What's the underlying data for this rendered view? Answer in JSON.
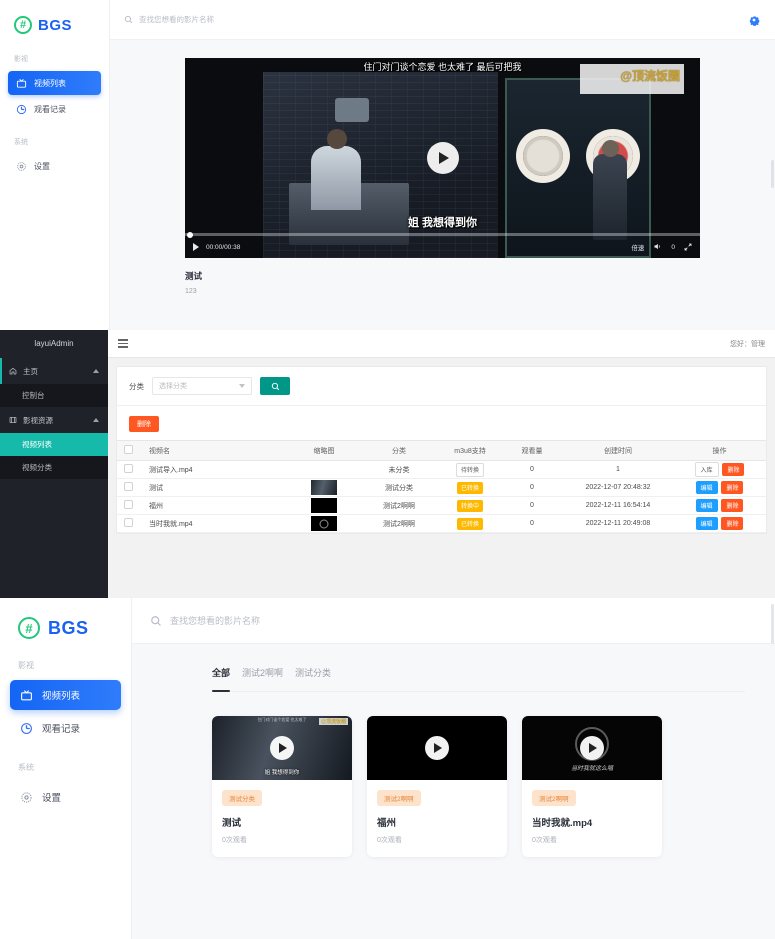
{
  "brand": {
    "name": "BGS",
    "mark": "#"
  },
  "colors": {
    "accent_blue": "#1565f5",
    "brand_green": "#21c978",
    "admin_teal": "#16baaa",
    "danger": "#ff5722",
    "warn": "#ffb800",
    "info": "#1e9fff"
  },
  "panel1": {
    "search": {
      "placeholder": "查找您想看的影片名称",
      "value": "",
      "icon": "search-icon"
    },
    "settings_icon": "gear-icon",
    "sidebar": {
      "groups": [
        {
          "label": "影视",
          "items": [
            {
              "label": "视频列表",
              "icon": "tv-icon",
              "active": true
            },
            {
              "label": "观看记录",
              "icon": "history-icon",
              "active": false
            }
          ]
        },
        {
          "label": "系统",
          "items": [
            {
              "label": "设置",
              "icon": "gear-icon",
              "active": false
            }
          ]
        }
      ]
    },
    "player": {
      "subtitle_top": "住门对门谈个恋爱 也太难了 最后可把我",
      "watermark": "@顶流饭圈",
      "subtitle_bottom": "姐 我想得到你",
      "time": "00:00/00:38",
      "speed_label": "倍速",
      "volume": "0",
      "play_icon": "play-icon",
      "fullscreen_icon": "fullscreen-icon",
      "volume_icon": "volume-icon"
    },
    "video": {
      "title": "测试",
      "description": "123"
    }
  },
  "panel2": {
    "brand": "layuiAdmin",
    "user_greeting": "您好：管理",
    "menu_icon": "hamburger-icon",
    "nav": [
      {
        "label": "主页",
        "icon": "home-icon",
        "expanded": true
      },
      {
        "label": "控制台",
        "sub": true,
        "active": false
      },
      {
        "label": "影视资源",
        "icon": "film-icon",
        "expanded": true
      },
      {
        "label": "视频列表",
        "sub": true,
        "active": true
      },
      {
        "label": "视频分类",
        "sub": true,
        "active": false
      }
    ],
    "filter": {
      "label": "分类",
      "select_placeholder": "选择分类",
      "search_icon": "search-icon"
    },
    "delete_button": "删除",
    "table": {
      "columns": [
        "",
        "视频名",
        "缩略图",
        "分类",
        "m3u8支持",
        "观看量",
        "创建时间",
        "操作"
      ],
      "rows": [
        {
          "name": "测试导入.mp4",
          "thumb": "none",
          "category": "未分类",
          "m3u8": "待转换",
          "m3u8_style": "wait",
          "views": "0",
          "created": "1",
          "actions": [
            "入库",
            "删除"
          ],
          "action_styles": [
            "ghost",
            "del"
          ]
        },
        {
          "name": "测试",
          "thumb": "img1",
          "category": "测试分类",
          "m3u8": "已转换",
          "m3u8_style": "warm",
          "views": "0",
          "created": "2022-12-07 20:48:32",
          "actions": [
            "编辑",
            "删除"
          ],
          "action_styles": [
            "edit",
            "del"
          ]
        },
        {
          "name": "福州",
          "thumb": "img2",
          "category": "测试2啊啊",
          "m3u8": "转换中",
          "m3u8_style": "warm",
          "views": "0",
          "created": "2022-12-11 16:54:14",
          "actions": [
            "编辑",
            "删除"
          ],
          "action_styles": [
            "edit",
            "del"
          ]
        },
        {
          "name": "当时我就.mp4",
          "thumb": "img3",
          "category": "测试2啊啊",
          "m3u8": "已转换",
          "m3u8_style": "warm",
          "views": "0",
          "created": "2022-12-11 20:49:08",
          "actions": [
            "编辑",
            "删除"
          ],
          "action_styles": [
            "edit",
            "del"
          ]
        }
      ]
    }
  },
  "panel3": {
    "search": {
      "placeholder": "查找您想看的影片名称",
      "value": "",
      "icon": "search-icon"
    },
    "sidebar": {
      "groups": [
        {
          "label": "影视",
          "items": [
            {
              "label": "视频列表",
              "icon": "tv-icon",
              "active": true
            },
            {
              "label": "观看记录",
              "icon": "history-icon",
              "active": false
            }
          ]
        },
        {
          "label": "系统",
          "items": [
            {
              "label": "设置",
              "icon": "gear-icon",
              "active": false
            }
          ]
        }
      ]
    },
    "tabs": [
      {
        "label": "全部",
        "active": true
      },
      {
        "label": "测试2啊啊",
        "active": false
      },
      {
        "label": "测试分类",
        "active": false
      }
    ],
    "cards": [
      {
        "tag": "测试分类",
        "title": "测试",
        "views": "0次观看",
        "thumb": "scene",
        "subtitle": "姐 我想得到你",
        "top_text": "住门对门谈个恋爱 也太难了",
        "watermark": "@顶流饭圈"
      },
      {
        "tag": "测试2啊啊",
        "title": "福州",
        "views": "0次观看",
        "thumb": "black"
      },
      {
        "tag": "测试2啊啊",
        "title": "当时我就.mp4",
        "views": "0次观看",
        "thumb": "ring",
        "caption": "当时我就这么唱"
      }
    ]
  }
}
